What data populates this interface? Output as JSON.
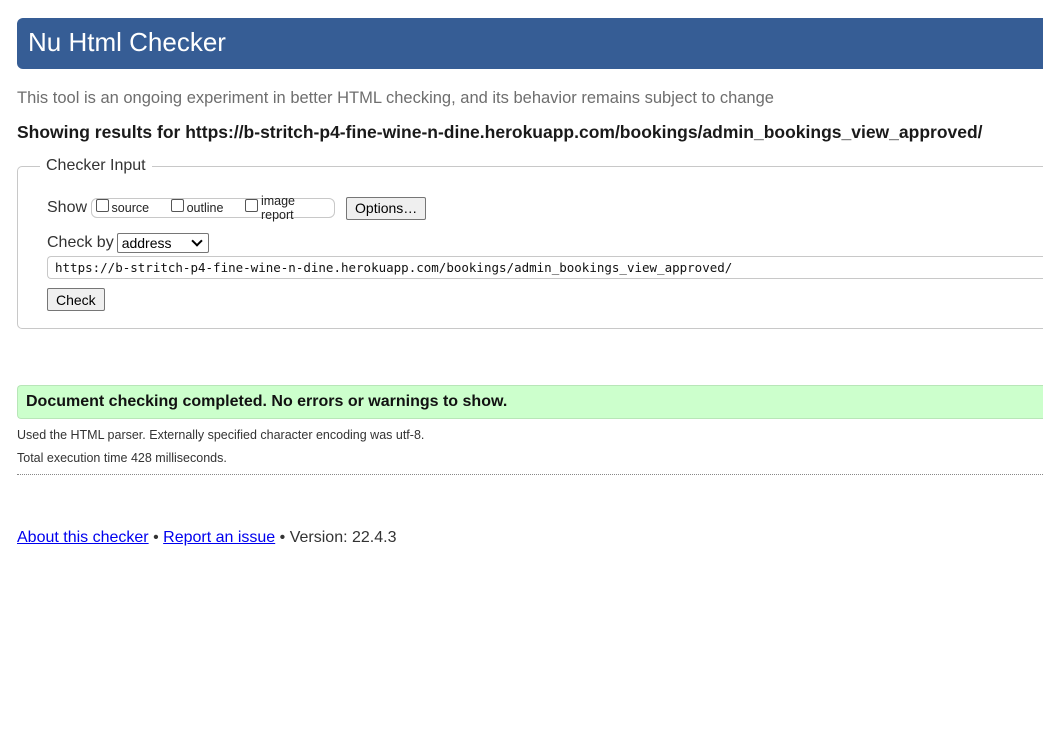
{
  "header": {
    "title": "Nu Html Checker"
  },
  "subtitle": "This tool is an ongoing experiment in better HTML checking, and its behavior remains subject to change",
  "results": {
    "heading_prefix": "Showing results for",
    "url": "https://b-stritch-p4-fine-wine-n-dine.herokuapp.com/bookings/admin_bookings_view_approved/"
  },
  "checker_input": {
    "legend": "Checker Input",
    "show_label": "Show",
    "checkboxes": [
      {
        "label": "source",
        "checked": false
      },
      {
        "label": "outline",
        "checked": false
      },
      {
        "label": "image report",
        "checked": false
      }
    ],
    "options_button": "Options…",
    "check_by_label": "Check by",
    "check_by_selected": "address",
    "url_value": "https://b-stritch-p4-fine-wine-n-dine.herokuapp.com/bookings/admin_bookings_view_approved/",
    "check_button": "Check"
  },
  "result_message": "Document checking completed. No errors or warnings to show.",
  "details": {
    "parser": "Used the HTML parser. Externally specified character encoding was utf-8.",
    "time": "Total execution time 428 milliseconds."
  },
  "footer": {
    "about_link": "About this checker",
    "separator": "•",
    "report_link": "Report an issue",
    "version": "Version: 22.4.3"
  },
  "colors": {
    "header_bg": "#365d95",
    "success_bg": "#ccffcc",
    "link": "#0000ee"
  }
}
